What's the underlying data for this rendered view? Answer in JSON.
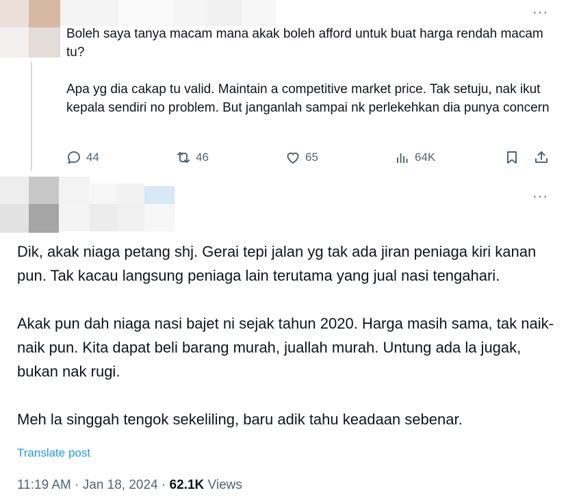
{
  "tweet1": {
    "paragraphs": [
      "Boleh saya tanya macam mana akak boleh afford untuk buat harga rendah macam tu?",
      "Apa yg dia cakap tu valid. Maintain a competitive market price. Tak setuju, nak ikut kepala sendiri no problem. But janganlah sampai nk perlekehkan dia punya concern"
    ],
    "more_label": "···",
    "actions": {
      "reply_count": "44",
      "retweet_count": "46",
      "like_count": "65",
      "views_count": "64K"
    }
  },
  "tweet2": {
    "more_label": "···",
    "paragraphs": [
      "Dik, akak niaga petang shj. Gerai tepi jalan yg tak ada jiran peniaga kiri kanan pun. Tak kacau langsung peniaga lain terutama yang jual nasi tengahari.",
      "Akak pun dah niaga nasi bajet ni sejak tahun 2020. Harga masih sama, tak naik-naik pun. Kita dapat beli barang murah, juallah murah. Untung ada la jugak, bukan nak rugi.",
      "Meh la singgah tengok sekeliling, baru adik tahu keadaan sebenar."
    ],
    "translate_label": "Translate post",
    "time": "11:19 AM",
    "separator": "·",
    "date": "Jan 18, 2024",
    "views_count": "62.1K",
    "views_label": "Views"
  },
  "colors": {
    "text": "#0f1419",
    "muted": "#536471",
    "link": "#1d9bf0",
    "thread_line": "#cfd9de"
  }
}
